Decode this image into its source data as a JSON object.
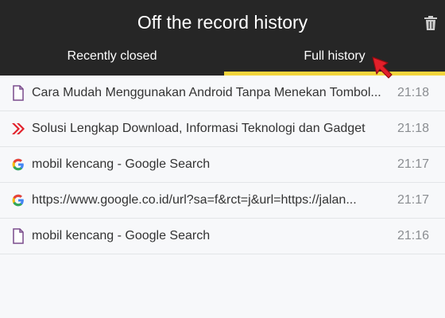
{
  "header": {
    "title": "Off the record history",
    "trash_icon": "trash-icon"
  },
  "tabs": [
    {
      "label": "Recently closed",
      "active": false
    },
    {
      "label": "Full history",
      "active": true
    }
  ],
  "colors": {
    "header_bg": "#262626",
    "active_tab_underline": "#f2d53c",
    "cursor": "#e2202a",
    "doc_icon": "#7a4b8c"
  },
  "items": [
    {
      "icon": "document-icon",
      "title": "Cara Mudah Menggunakan Android Tanpa Menekan Tombol...",
      "time": "21:18"
    },
    {
      "icon": "red-chevron-icon",
      "title": "Solusi Lengkap Download, Informasi Teknologi dan Gadget",
      "time": "21:18"
    },
    {
      "icon": "google-icon",
      "title": "mobil kencang - Google Search",
      "time": "21:17"
    },
    {
      "icon": "google-icon",
      "title": "https://www.google.co.id/url?sa=f&rct=j&url=https://jalan...",
      "time": "21:17"
    },
    {
      "icon": "document-icon",
      "title": "mobil kencang - Google Search",
      "time": "21:16"
    }
  ]
}
